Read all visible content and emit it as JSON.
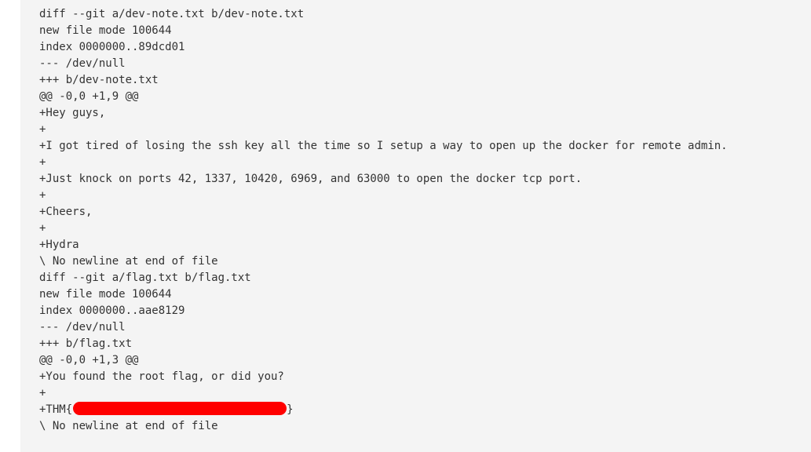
{
  "diff": {
    "lines": [
      "diff --git a/dev-note.txt b/dev-note.txt",
      "new file mode 100644",
      "index 0000000..89dcd01",
      "--- /dev/null",
      "+++ b/dev-note.txt",
      "@@ -0,0 +1,9 @@",
      "+Hey guys,",
      "+",
      "+I got tired of losing the ssh key all the time so I setup a way to open up the docker for remote admin.",
      "+",
      "+Just knock on ports 42, 1337, 10420, 6969, and 63000 to open the docker tcp port.",
      "+",
      "+Cheers,",
      "+",
      "+Hydra",
      "\\ No newline at end of file",
      "diff --git a/flag.txt b/flag.txt",
      "new file mode 100644",
      "index 0000000..aae8129",
      "--- /dev/null",
      "+++ b/flag.txt",
      "@@ -0,0 +1,3 @@",
      "+You found the root flag, or did you?",
      "+"
    ],
    "flag_prefix": "+THM{",
    "flag_suffix": "}",
    "redaction_color": "#ff0000",
    "last_line": "\\ No newline at end of file"
  }
}
